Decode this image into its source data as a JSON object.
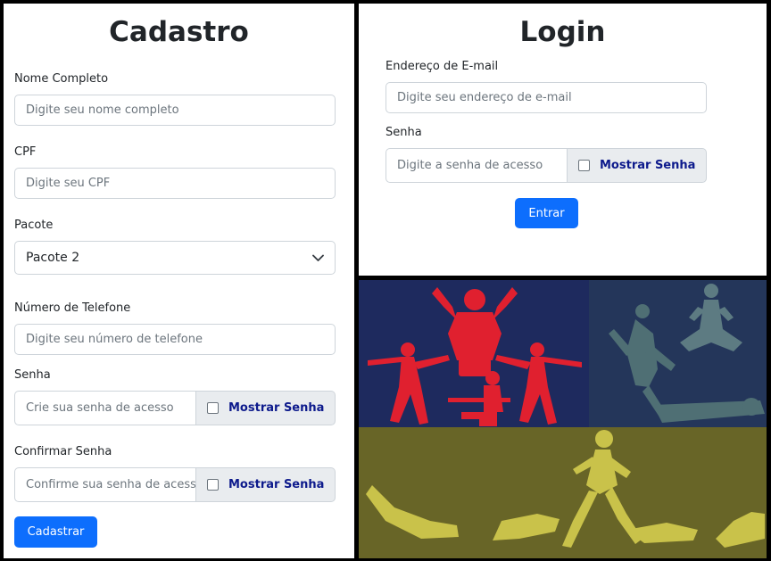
{
  "cadastro": {
    "title": "Cadastro",
    "full_name": {
      "label": "Nome Completo",
      "placeholder": "Digite seu nome completo"
    },
    "cpf": {
      "label": "CPF",
      "placeholder": "Digite seu CPF"
    },
    "package": {
      "label": "Pacote",
      "selected": "Pacote 2"
    },
    "phone": {
      "label": "Número de Telefone",
      "placeholder": "Digite seu número de telefone"
    },
    "password": {
      "label": "Senha",
      "placeholder": "Crie sua senha de acesso",
      "toggle_label": "Mostrar Senha"
    },
    "confirm_password": {
      "label": "Confirmar Senha",
      "placeholder": "Confirme sua senha de acesso",
      "toggle_label": "Mostrar Senha"
    },
    "submit_label": "Cadastrar"
  },
  "login": {
    "title": "Login",
    "email": {
      "label": "Endereço de E-mail",
      "placeholder": "Digite seu endereço de e-mail"
    },
    "password": {
      "label": "Senha",
      "placeholder": "Digite a senha de acesso",
      "toggle_label": "Mostrar Senha"
    },
    "submit_label": "Entrar"
  },
  "banner": {
    "colors": {
      "navy": "#1e2a5e",
      "red": "#e0202f",
      "slate": "#4a6a78",
      "olive": "#6b6a2a",
      "yellow": "#c9c24a"
    }
  },
  "theme": {
    "primary": "#0d6efd",
    "toggle_text": "#0d1a8c",
    "addon_bg": "#e9ecef",
    "border": "#ced4da"
  }
}
